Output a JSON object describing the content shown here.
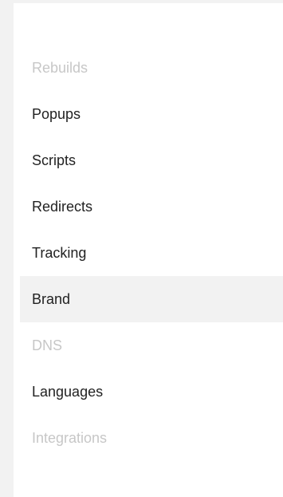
{
  "menu": {
    "items": [
      {
        "label": "Rebuilds",
        "state": "disabled"
      },
      {
        "label": "Popups",
        "state": "normal"
      },
      {
        "label": "Scripts",
        "state": "normal"
      },
      {
        "label": "Redirects",
        "state": "normal"
      },
      {
        "label": "Tracking",
        "state": "normal"
      },
      {
        "label": "Brand",
        "state": "active"
      },
      {
        "label": "DNS",
        "state": "disabled"
      },
      {
        "label": "Languages",
        "state": "normal"
      },
      {
        "label": "Integrations",
        "state": "disabled"
      }
    ]
  },
  "colors": {
    "background": "#f2f2f2",
    "panel": "#ffffff",
    "text": "#222222",
    "disabled_text": "#c7c7c7",
    "active_bg": "#f2f2f2"
  }
}
